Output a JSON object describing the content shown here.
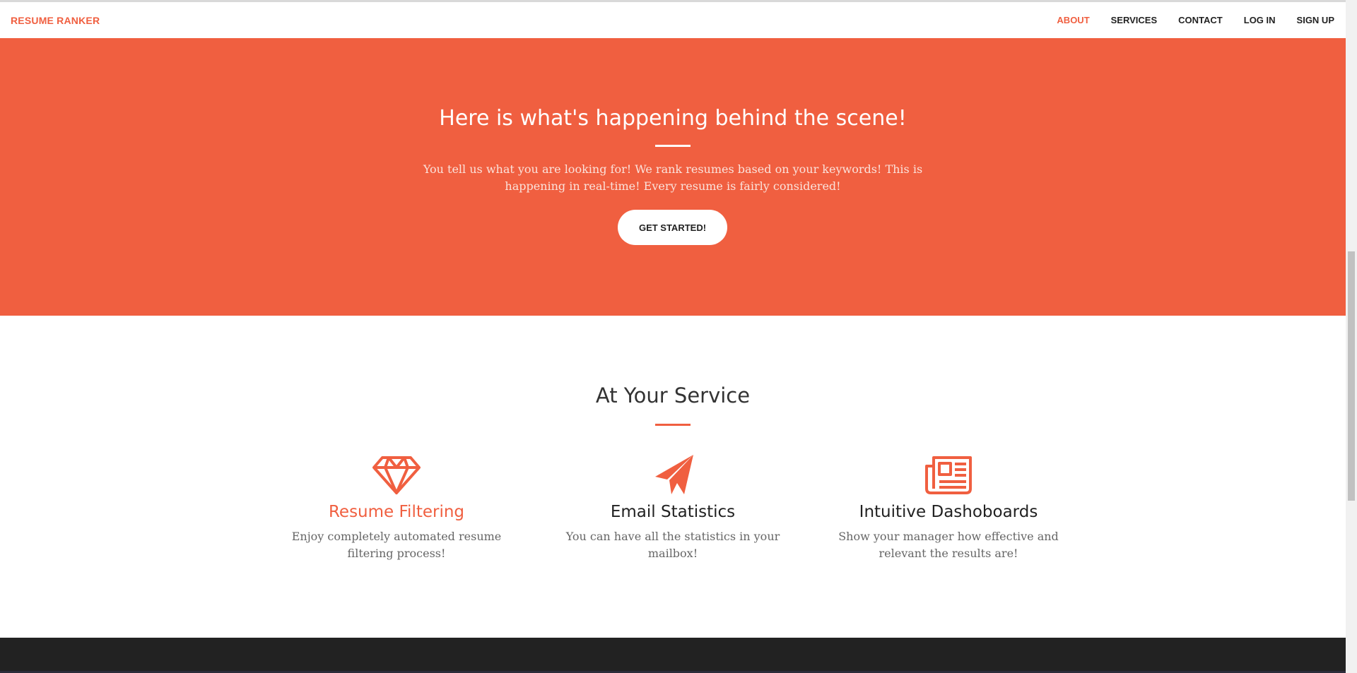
{
  "navbar": {
    "brand": "RESUME RANKER",
    "links": [
      {
        "label": "ABOUT",
        "active": true
      },
      {
        "label": "SERVICES",
        "active": false
      },
      {
        "label": "CONTACT",
        "active": false
      },
      {
        "label": "LOG IN",
        "active": false
      },
      {
        "label": "SIGN UP",
        "active": false
      }
    ]
  },
  "hero": {
    "title": "Here is what's happening behind the scene!",
    "text": "You tell us what you are looking for! We rank resumes based on your keywords! This is happening in real-time! Every resume is fairly considered!",
    "button_label": "GET STARTED!"
  },
  "services": {
    "title": "At Your Service",
    "items": [
      {
        "icon": "diamond-icon",
        "title": "Resume Filtering",
        "text": "Enjoy completely automated resume filtering process!"
      },
      {
        "icon": "paper-plane-icon",
        "title": "Email Statistics",
        "text": "You can have all the statistics in your mailbox!"
      },
      {
        "icon": "newspaper-icon",
        "title": "Intuitive Dashoboards",
        "text": "Show your manager how effective and relevant the results are!"
      }
    ]
  },
  "colors": {
    "accent": "#f05f40",
    "dark": "#222222",
    "white": "#ffffff"
  }
}
